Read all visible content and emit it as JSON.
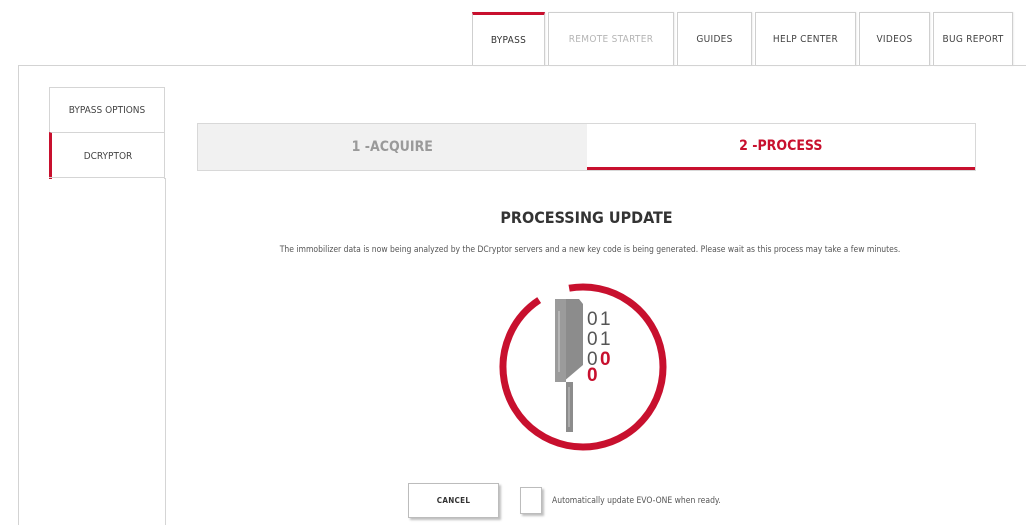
{
  "top_tabs": [
    {
      "label": "BYPASS",
      "state": "active"
    },
    {
      "label": "REMOTE STARTER",
      "state": "disabled"
    },
    {
      "label": "GUIDES",
      "state": "normal"
    },
    {
      "label": "HELP CENTER",
      "state": "normal"
    },
    {
      "label": "VIDEOS",
      "state": "normal"
    },
    {
      "label": "BUG REPORT",
      "state": "normal"
    }
  ],
  "side_tabs": [
    {
      "label": "BYPASS OPTIONS",
      "state": "normal"
    },
    {
      "label": "DCRYPTOR",
      "state": "active"
    }
  ],
  "steps": [
    {
      "label": "1 -ACQUIRE",
      "state": "inactive"
    },
    {
      "label": "2 -PROCESS",
      "state": "active"
    }
  ],
  "content": {
    "heading": "PROCESSING UPDATE",
    "description": "The immobilizer data is now being analyzed by the DCryptor servers and a new key code is being generated. Please wait as this process may take a few minutes.",
    "illustration": {
      "icon": "key-binary-processing-icon",
      "digits": [
        [
          "0",
          "1"
        ],
        [
          "0",
          "1"
        ],
        [
          "0",
          "0"
        ],
        [
          "0"
        ]
      ]
    }
  },
  "footer": {
    "cancel_label": "CANCEL",
    "auto_update_label": "Automatically update EVO-ONE when ready.",
    "auto_update_checked": false
  },
  "colors": {
    "accent": "#c8102e",
    "gray_text": "#9a9a9a",
    "key_gray": "#8c8c8c"
  }
}
